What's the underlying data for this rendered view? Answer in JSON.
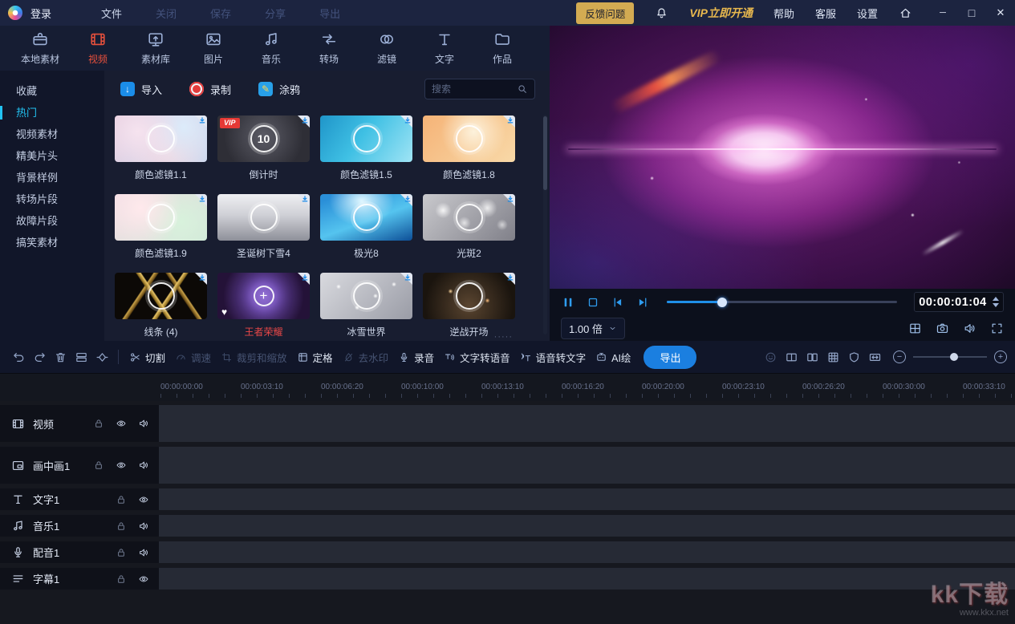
{
  "colors": {
    "accent_blue": "#1f8fe8",
    "accent_cyan": "#22c3f2",
    "active_red": "#e8503c",
    "vip_gold": "#e8b84e",
    "export_blue": "#1b7fe0"
  },
  "titlebar": {
    "login": "登录",
    "menu": [
      {
        "label": "文件",
        "enabled": true
      },
      {
        "label": "关闭",
        "enabled": false
      },
      {
        "label": "保存",
        "enabled": false
      },
      {
        "label": "分享",
        "enabled": false
      },
      {
        "label": "导出",
        "enabled": false
      }
    ],
    "feedback": "反馈问题",
    "vip": "VIP立即开通",
    "links": [
      {
        "label": "帮助"
      },
      {
        "label": "客服"
      },
      {
        "label": "设置"
      }
    ]
  },
  "ribbon": {
    "tabs": [
      {
        "label": "本地素材",
        "icon": "toolbox",
        "active": false
      },
      {
        "label": "视频",
        "icon": "film",
        "active": true
      },
      {
        "label": "素材库",
        "icon": "library",
        "active": false
      },
      {
        "label": "图片",
        "icon": "picture",
        "active": false
      },
      {
        "label": "音乐",
        "icon": "music",
        "active": false
      },
      {
        "label": "转场",
        "icon": "transition",
        "active": false
      },
      {
        "label": "滤镜",
        "icon": "filter",
        "active": false
      },
      {
        "label": "文字",
        "icon": "text",
        "active": false
      },
      {
        "label": "作品",
        "icon": "folder",
        "active": false
      }
    ]
  },
  "sidebar": {
    "items": [
      {
        "label": "收藏",
        "active": false
      },
      {
        "label": "热门",
        "active": true
      },
      {
        "label": "视频素材",
        "active": false
      },
      {
        "label": "精美片头",
        "active": false
      },
      {
        "label": "背景样例",
        "active": false
      },
      {
        "label": "转场片段",
        "active": false
      },
      {
        "label": "故障片段",
        "active": false
      },
      {
        "label": "搞笑素材",
        "active": false
      }
    ]
  },
  "media": {
    "actions": [
      {
        "label": "导入",
        "icon": "import"
      },
      {
        "label": "录制",
        "icon": "record"
      },
      {
        "label": "涂鸦",
        "icon": "doodle"
      }
    ],
    "search_placeholder": "搜索",
    "vip_badge": "VIP",
    "items": [
      {
        "label": "颜色滤镜1.1"
      },
      {
        "label": "倒计时",
        "vip": true,
        "overlay": "10"
      },
      {
        "label": "颜色滤镜1.5"
      },
      {
        "label": "颜色滤镜1.8"
      },
      {
        "label": "颜色滤镜1.9"
      },
      {
        "label": "圣诞树下雪4"
      },
      {
        "label": "极光8"
      },
      {
        "label": "光斑2"
      },
      {
        "label": "线条 (4)"
      },
      {
        "label": "王者荣耀",
        "overlay": "+",
        "favorite": true,
        "selected": true
      },
      {
        "label": "冰雪世界"
      },
      {
        "label": "逆战开场"
      }
    ]
  },
  "preview": {
    "timecode": "00:00:01:04",
    "speed": "1.00 倍",
    "progress_percent": 24
  },
  "toolbar": {
    "icon_buttons": [
      {
        "icon": "undo",
        "name": "undo"
      },
      {
        "icon": "redo",
        "name": "redo"
      },
      {
        "icon": "trash",
        "name": "delete"
      },
      {
        "icon": "sequence",
        "name": "storyboard"
      },
      {
        "icon": "keyframe",
        "name": "keyframe"
      }
    ],
    "labeled_buttons": [
      {
        "label": "切割",
        "icon": "scissors",
        "enabled": true
      },
      {
        "label": "调速",
        "icon": "gauge",
        "enabled": false
      },
      {
        "label": "裁剪和缩放",
        "icon": "crop",
        "enabled": false
      },
      {
        "label": "定格",
        "icon": "freeze",
        "enabled": true
      },
      {
        "label": "去水印",
        "icon": "droplet",
        "enabled": false
      },
      {
        "label": "录音",
        "icon": "mic",
        "enabled": true
      },
      {
        "label": "文字转语音",
        "icon": "tts",
        "enabled": true
      },
      {
        "label": "语音转文字",
        "icon": "stt",
        "enabled": true
      },
      {
        "label": "AI绘",
        "icon": "ai",
        "enabled": true
      }
    ],
    "export_label": "导出",
    "right_icons": [
      {
        "icon": "smile",
        "name": "sticker",
        "enabled": false
      },
      {
        "icon": "splitview",
        "name": "split-view",
        "enabled": true
      },
      {
        "icon": "pages",
        "name": "dual-page",
        "enabled": true
      },
      {
        "icon": "mosaic",
        "name": "mosaic",
        "enabled": true
      },
      {
        "icon": "shield",
        "name": "shield",
        "enabled": true
      },
      {
        "icon": "harrows",
        "name": "expand-horizontal",
        "enabled": true
      }
    ]
  },
  "timeline": {
    "ruler": [
      "00:00:00:00",
      "00:00:03:10",
      "00:00:06:20",
      "00:00:10:00",
      "00:00:13:10",
      "00:00:16:20",
      "00:00:20:00",
      "00:00:23:10",
      "00:00:26:20",
      "00:00:30:00",
      "00:00:33:10"
    ],
    "tracks": [
      {
        "label": "视频",
        "icon": "film",
        "tall": true,
        "controls": [
          "lock",
          "eye",
          "speaker"
        ]
      },
      {
        "label": "画中画1",
        "icon": "pip",
        "tall": true,
        "controls": [
          "lock",
          "eye",
          "speaker"
        ]
      },
      {
        "label": "文字1",
        "icon": "text",
        "tall": false,
        "controls": [
          "lock",
          "eye"
        ]
      },
      {
        "label": "音乐1",
        "icon": "music",
        "tall": false,
        "controls": [
          "lock",
          "speaker"
        ]
      },
      {
        "label": "配音1",
        "icon": "mic",
        "tall": false,
        "controls": [
          "lock",
          "speaker"
        ]
      },
      {
        "label": "字幕1",
        "icon": "subtitle",
        "tall": false,
        "controls": [
          "lock",
          "eye"
        ]
      }
    ]
  },
  "watermark": {
    "text": "kk下载",
    "site": "www.kkx.net"
  }
}
